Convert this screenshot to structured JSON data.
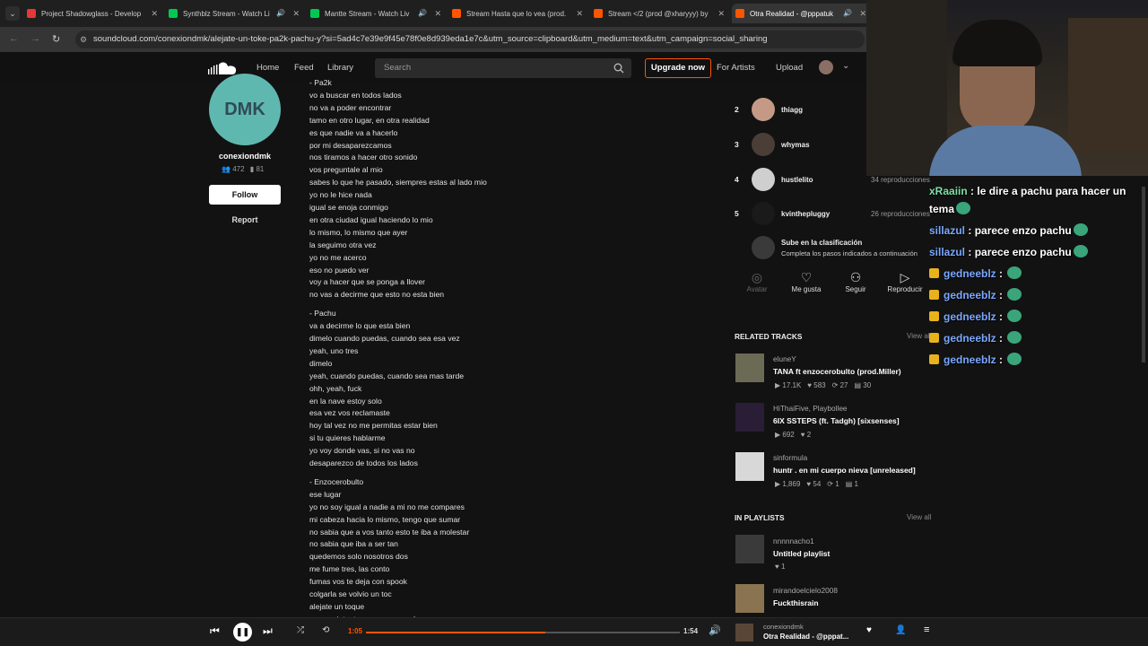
{
  "tabs": [
    {
      "title": "Project Shadowglass - Develop",
      "color": "#e53935",
      "speaker": false
    },
    {
      "title": "Synthblz Stream - Watch Li",
      "color": "#00c853",
      "speaker": true
    },
    {
      "title": "Mantte Stream - Watch Liv",
      "color": "#00c853",
      "speaker": true
    },
    {
      "title": "Stream Hasta que lo vea (prod.",
      "color": "#ff5500",
      "speaker": false
    },
    {
      "title": "Stream </2 (prod @xharyyy) by",
      "color": "#ff5500",
      "speaker": false
    },
    {
      "title": "Otra Realidad - @pppatuk",
      "color": "#ff5500",
      "speaker": true
    }
  ],
  "address": {
    "url": "soundcloud.com/conexiondmk/alejate-un-toke-pa2k-pachu-y?si=5ad4c7e39e9f45e78f0e8d939eda1e7c&utm_source=clipboard&utm_medium=text&utm_campaign=social_sharing"
  },
  "header": {
    "home": "Home",
    "feed": "Feed",
    "library": "Library",
    "search_placeholder": "Search",
    "upgrade": "Upgrade now",
    "for_artists": "For Artists",
    "upload": "Upload"
  },
  "artist": {
    "avatar_text": "DMK",
    "name": "conexiondmk",
    "followers": "472",
    "following": "81",
    "follow": "Follow",
    "report": "Report"
  },
  "lyrics": [
    "- Pa2k",
    "vo a buscar en todos lados",
    "no va a poder encontrar",
    "tamo en otro lugar, en otra realidad",
    "es que nadie va a hacerlo",
    "por mi desaparezcamos",
    "nos tiramos a hacer otro sonido",
    "vos preguntale al mio",
    "sabes lo que he pasado, siempres estas al lado mio",
    "yo no le hice nada",
    "igual se enoja conmigo",
    "en otra ciudad igual haciendo lo mio",
    "lo mismo, lo mismo que ayer",
    "la seguimo otra vez",
    "yo no me acerco",
    "eso no puedo ver",
    "voy a hacer que se ponga a llover",
    "no vas a decirme que esto no esta bien",
    "",
    "- Pachu",
    "va a decirme lo que esta bien",
    "dimelo cuando puedas, cuando sea esa vez",
    "yeah, uno tres",
    "dimelo",
    "yeah, cuando puedas, cuando sea mas tarde",
    "ohh, yeah, fuck",
    "en la nave estoy solo",
    "esa vez vos reclamaste",
    "hoy tal vez no me permitas estar bien",
    "si tu quieres hablarme",
    "yo voy donde vas, si no vas no",
    "desaparezco de todos los lados",
    "",
    "- Enzocerobulto",
    "ese lugar",
    "yo no soy igual a nadie a mi no me compares",
    "mi cabeza hacia lo mismo, tengo que sumar",
    "no sabia que a vos tanto esto te iba a molestar",
    "no sabia que iba a ser tan",
    "quedemos solo nosotros dos",
    "me fume tres, las conto",
    "fumas vos te deja con spook",
    "colgarla se volvio un toc",
    "alejate un toque",
    "vamo a intentar que sea un gol"
  ],
  "ranking": [
    {
      "rank": "2",
      "name": "thiagg",
      "plays": ""
    },
    {
      "rank": "3",
      "name": "whymas",
      "plays": ""
    },
    {
      "rank": "4",
      "name": "hustlelito",
      "plays": "34 reproducciones"
    },
    {
      "rank": "5",
      "name": "kvinthepluggy",
      "plays": "26 reproducciones"
    }
  ],
  "climb": {
    "title": "Sube en la clasificación",
    "subtitle": "Completa los pasos indicados a continuación"
  },
  "actions": {
    "avatar": "Avatar",
    "like": "Me gusta",
    "follow": "Seguir",
    "play": "Reproducir"
  },
  "related": {
    "title": "RELATED TRACKS",
    "view_all": "View all",
    "tracks": [
      {
        "user": "eluneY",
        "title": "TANA ft enzocerobulto (prod.Miller)",
        "plays": "17.1K",
        "likes": "583",
        "reposts": "27",
        "comments": "30"
      },
      {
        "user": "HiThaiFive, Playbollee",
        "title": "6IX SSTEPS (ft. Tadgh) [sixsenses]",
        "plays": "692",
        "likes": "2",
        "reposts": "",
        "comments": ""
      },
      {
        "user": "sinformula",
        "title": "huntr . en mi cuerpo nieva [unreleased]",
        "plays": "1,869",
        "likes": "54",
        "reposts": "1",
        "comments": "1"
      }
    ]
  },
  "playlists": {
    "title": "IN PLAYLISTS",
    "view_all": "View all",
    "items": [
      {
        "user": "nnnnnacho1",
        "title": "Untitled playlist",
        "likes": "1"
      },
      {
        "user": "mirandoelcielo2008",
        "title": "Fuckthisrain",
        "likes": ""
      }
    ]
  },
  "player": {
    "elapsed": "1:05",
    "duration": "1:54",
    "progress": 0.57,
    "track_user": "conexiondmk",
    "track_title": "Otra Realidad - @pppat..."
  },
  "chat": [
    {
      "user": "xRaaiin",
      "message": "le dire a pachu para hacer un tema",
      "user_color": "green",
      "badge": false
    },
    {
      "user": "sillazul",
      "message": "parece enzo pachu",
      "user_color": "blue",
      "badge": false
    },
    {
      "user": "sillazul",
      "message": "parece enzo pachu",
      "user_color": "blue",
      "badge": false
    },
    {
      "user": "gedneeblz",
      "message": "",
      "user_color": "blue",
      "badge": true
    },
    {
      "user": "gedneeblz",
      "message": "",
      "user_color": "blue",
      "badge": true
    },
    {
      "user": "gedneeblz",
      "message": "",
      "user_color": "blue",
      "badge": true
    },
    {
      "user": "gedneeblz",
      "message": "",
      "user_color": "blue",
      "badge": true
    },
    {
      "user": "gedneeblz",
      "message": "",
      "user_color": "blue",
      "badge": true
    }
  ]
}
